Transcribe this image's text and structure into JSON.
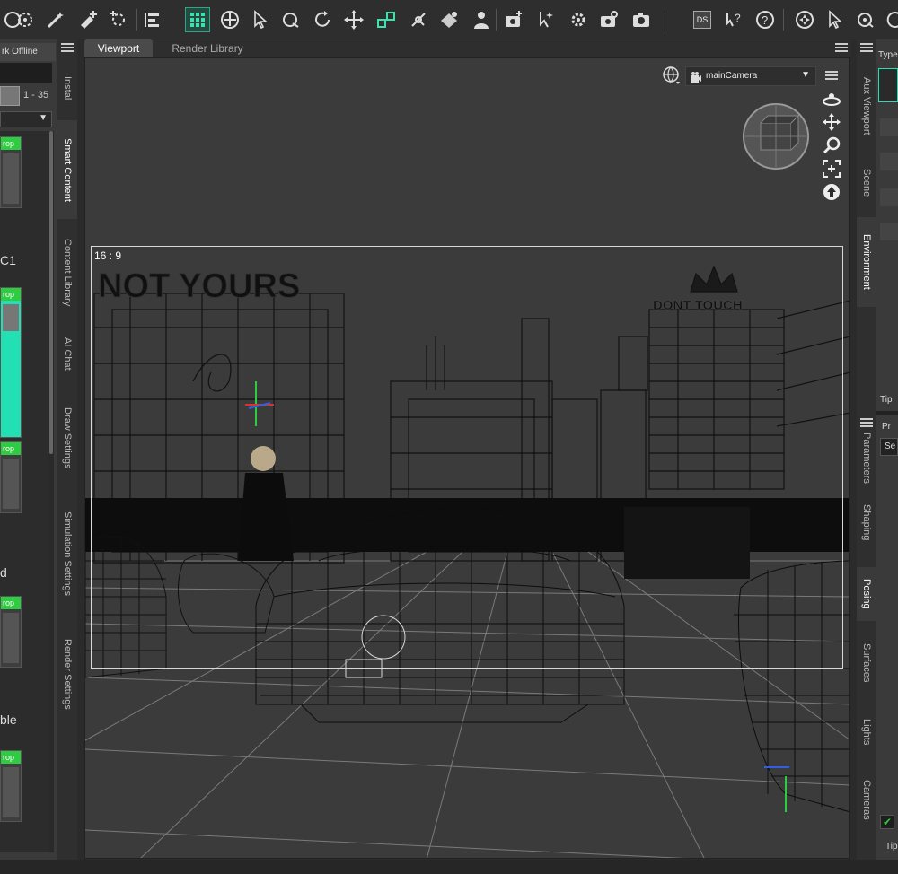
{
  "toolbar": {
    "icons": [
      "select-icon",
      "universal-icon",
      "magic-wand-icon",
      "add-node-icon",
      "spot-render-icon",
      "align-icon",
      "grid-active-icon",
      "move-crosshair-icon",
      "pointer-icon",
      "rotate-icon",
      "twist-icon",
      "translate-icon",
      "node-active-icon",
      "joint-editor-icon",
      "geometry-editor-icon",
      "figure-icon",
      "render-settings-icon",
      "rigging-icon",
      "scene-settings-icon",
      "camera-icon",
      "render-icon",
      "ds-icon",
      "help-cursor-icon",
      "help-icon",
      "navigate-icon",
      "cursor-icon",
      "orbit-icon",
      "more-icon"
    ],
    "ds_label": "DS"
  },
  "left_pane": {
    "header": "rk Offline",
    "page_range": "1 - 35",
    "badge": "rop",
    "list_text_1": "C1",
    "list_text_2": "d",
    "list_text_3": "ble"
  },
  "left_tabs": [
    "Install",
    "Smart Content",
    "Content Library",
    "AI Chat",
    "Draw Settings",
    "Simulation Settings",
    "Render Settings"
  ],
  "viewport_tabs": [
    "Viewport",
    "Render Library"
  ],
  "viewport": {
    "camera": "mainCamera",
    "aspect": "16 : 9",
    "sign_left": "NOT YOURS",
    "sign_right": "DONT TOUCH"
  },
  "right_tabs_top": [
    "Aux Viewport",
    "Scene",
    "Environment"
  ],
  "right_tabs_bottom": [
    "Parameters",
    "Shaping",
    "Posing",
    "Surfaces",
    "Lights",
    "Cameras"
  ],
  "right_pane": {
    "label_type": "Type",
    "label_tips": "Tip",
    "label_pr": "Pr",
    "label_se": "Se"
  },
  "colors": {
    "accent": "#2fa58a",
    "badge": "#2ecc40",
    "selected": "#22e0b4",
    "background": "#2b2b2b"
  }
}
